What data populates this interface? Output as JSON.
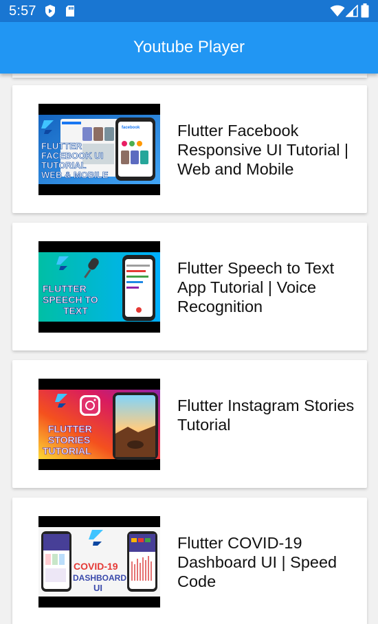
{
  "status_bar": {
    "time": "5:57",
    "icons": [
      "play-protect-icon",
      "sd-card-icon",
      "wifi-icon",
      "signal-icon",
      "battery-icon"
    ]
  },
  "app_bar": {
    "title": "Youtube Player",
    "color": "#2196f3"
  },
  "videos": [
    {
      "title": "Flutter Facebook Responsive UI Tutorial | Web and Mobile",
      "thumbnail_text": [
        "FLUTTER",
        "FACEBOOK UI",
        "TUTORIAL",
        "WEB & MOBILE"
      ],
      "thumbnail_icon": "facebook"
    },
    {
      "title": "Flutter Speech to Text App Tutorial | Voice Recognition",
      "thumbnail_text": [
        "FLUTTER",
        "SPEECH TO",
        "TEXT"
      ],
      "thumbnail_icon": "microphone"
    },
    {
      "title": "Flutter Instagram Stories Tutorial",
      "thumbnail_text": [
        "FLUTTER",
        "STORIES",
        "TUTORIAL"
      ],
      "thumbnail_icon": "instagram"
    },
    {
      "title": "Flutter COVID-19 Dashboard UI | Speed Code",
      "thumbnail_text": [
        "COVID-19",
        "DASHBOARD",
        "UI"
      ],
      "thumbnail_icon": "dashboard"
    }
  ]
}
